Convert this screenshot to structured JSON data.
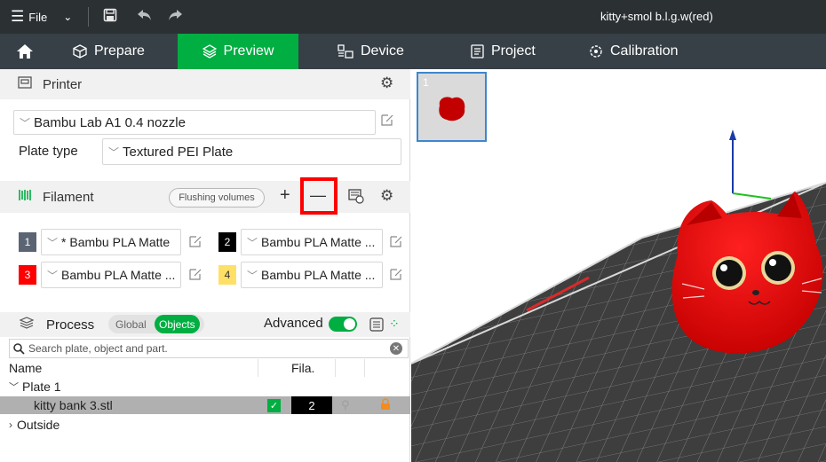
{
  "titlebar": {
    "file_label": "File",
    "title": "kitty+smol b.l.g.w(red)"
  },
  "tabs": {
    "prepare": "Prepare",
    "preview": "Preview",
    "device": "Device",
    "project": "Project",
    "calibration": "Calibration"
  },
  "printer": {
    "header": "Printer",
    "selected_printer": "Bambu Lab A1 0.4 nozzle",
    "plate_type_label": "Plate type",
    "plate_type_value": "Textured PEI Plate"
  },
  "filament": {
    "header": "Filament",
    "flushing_button": "Flushing volumes",
    "add_symbol": "+",
    "remove_symbol": "—",
    "slots": [
      {
        "num": "1",
        "name": "* Bambu PLA Matte",
        "color": "#5b6472"
      },
      {
        "num": "2",
        "name": "Bambu PLA Matte ...",
        "color": "#000000"
      },
      {
        "num": "3",
        "name": "Bambu PLA Matte ...",
        "color": "#ff0000"
      },
      {
        "num": "4",
        "name": "Bambu PLA Matte ...",
        "color": "#ffe066"
      }
    ]
  },
  "process": {
    "header": "Process",
    "global_label": "Global",
    "objects_label": "Objects",
    "advanced_label": "Advanced",
    "advanced_on": true
  },
  "objects": {
    "search_placeholder": "Search plate, object and part.",
    "col_name": "Name",
    "col_fila": "Fila.",
    "plate": "Plate 1",
    "object_name": "kitty bank 3.stl",
    "object_filament": "2",
    "outside": "Outside"
  },
  "plate_thumb_number": "1",
  "colors": {
    "accent": "#00ae42",
    "titlebar": "#2b3033",
    "tabbar": "#374047",
    "highlight": "#ff0000",
    "thumb_border": "#3d87cf"
  }
}
